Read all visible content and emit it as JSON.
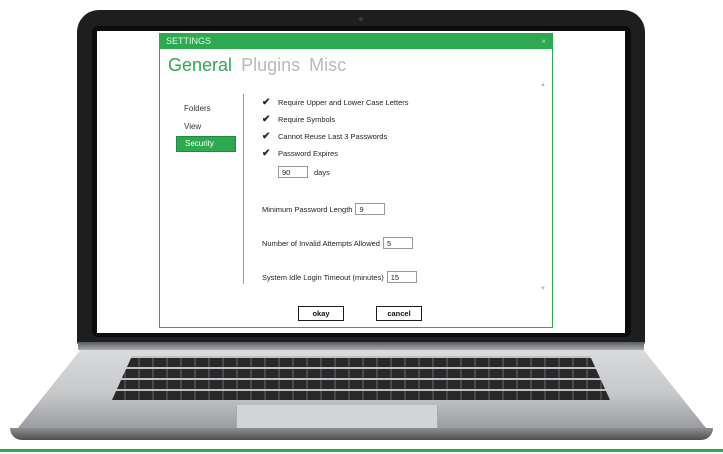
{
  "window": {
    "title": "SETTINGS",
    "close_glyph": "×"
  },
  "tabs": [
    {
      "label": "General",
      "active": true
    },
    {
      "label": "Plugins",
      "active": false
    },
    {
      "label": "Misc",
      "active": false
    }
  ],
  "nav": [
    {
      "label": "Folders",
      "selected": false
    },
    {
      "label": "View",
      "selected": false
    },
    {
      "label": "Security",
      "selected": true
    }
  ],
  "checkboxes": [
    {
      "label": "Require Upper and Lower Case Letters",
      "checked": true
    },
    {
      "label": "Require Symbols",
      "checked": true
    },
    {
      "label": "Cannot Reuse Last 3 Passwords",
      "checked": true
    },
    {
      "label": "Password Expires",
      "checked": true
    }
  ],
  "expiry": {
    "value": "90",
    "unit": "days"
  },
  "fields": [
    {
      "label": "Minimum Password Length",
      "value": "9"
    },
    {
      "label": "Number of Invalid Attempts Allowed",
      "value": "5"
    },
    {
      "label": "System Idle Login Timeout (minutes)",
      "value": "15"
    }
  ],
  "buttons": {
    "ok": "okay",
    "cancel": "cancel"
  },
  "icons": {
    "check": "✔",
    "scroll_up": "▲",
    "scroll_down": "▼"
  },
  "colors": {
    "accent": "#2da94f"
  }
}
